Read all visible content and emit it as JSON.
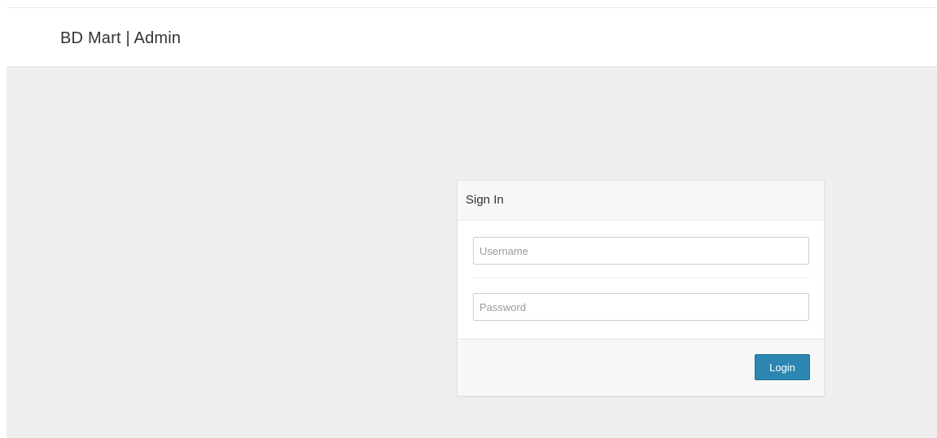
{
  "header": {
    "brand": "BD Mart | Admin"
  },
  "signin": {
    "title": "Sign In",
    "username_placeholder": "Username",
    "password_placeholder": "Password",
    "login_label": "Login"
  },
  "colors": {
    "accent": "#2b86b2",
    "page_background": "#efefef"
  }
}
